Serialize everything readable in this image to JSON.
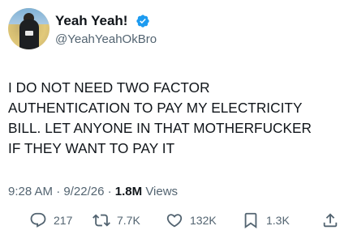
{
  "author": {
    "display_name": "Yeah Yeah!",
    "handle": "@YeahYeahOkBro",
    "verified_icon": "verified-badge-icon",
    "avatar_icon": "avatar-basketball-player"
  },
  "tweet": {
    "lines": [
      "I DO NOT NEED TWO FACTOR",
      "AUTHENTICATION TO PAY MY ELECTRICITY",
      "BILL. LET ANYONE IN THAT MOTHERFUCKER",
      "IF THEY WANT TO PAY IT"
    ]
  },
  "meta": {
    "time": "9:28 AM",
    "sep1": "·",
    "date": "9/22/26",
    "sep2": "·",
    "views_count": "1.8M",
    "views_label": "Views"
  },
  "actions": {
    "reply": "217",
    "retweet": "7.7K",
    "like": "132K",
    "bookmark": "1.3K"
  },
  "colors": {
    "text": "#0f1419",
    "secondary": "#536471",
    "verified": "#1d9bf0"
  }
}
